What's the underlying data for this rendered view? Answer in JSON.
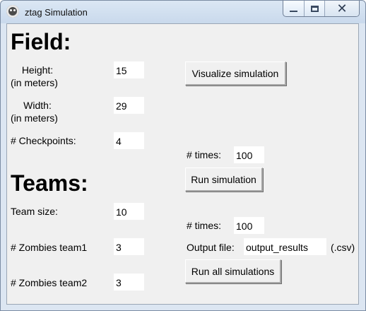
{
  "window": {
    "title": "ztag Simulation",
    "controls": {
      "minimize_icon": "minimize-icon",
      "maximize_icon": "maximize-icon",
      "close_label": "✕"
    }
  },
  "field": {
    "heading": "Field:",
    "height": {
      "label": "Height:",
      "unit": "(in meters)",
      "value": "15"
    },
    "width": {
      "label": "Width:",
      "unit": "(in meters)",
      "value": "29"
    },
    "checkpoints": {
      "label": "# Checkpoints:",
      "value": "4"
    }
  },
  "teams": {
    "heading": "Teams:",
    "team_size": {
      "label": "Team size:",
      "value": "10"
    },
    "zombies_team1": {
      "label": "# Zombies team1",
      "value": "3"
    },
    "zombies_team2": {
      "label": "# Zombies team2",
      "value": "3"
    }
  },
  "visualize": {
    "button_label": "Visualize simulation"
  },
  "run": {
    "times_label": "# times:",
    "times_value": "100",
    "button_label": "Run simulation"
  },
  "run_all": {
    "times_label": "# times:",
    "times_value": "100",
    "output_label": "Output file:",
    "output_value": "output_results",
    "extension_label": "(.csv)",
    "button_label": "Run all simulations"
  },
  "colors": {
    "window_frame": "#dce6f2",
    "client_background": "#f0f0f0",
    "entry_background": "#ffffff"
  }
}
